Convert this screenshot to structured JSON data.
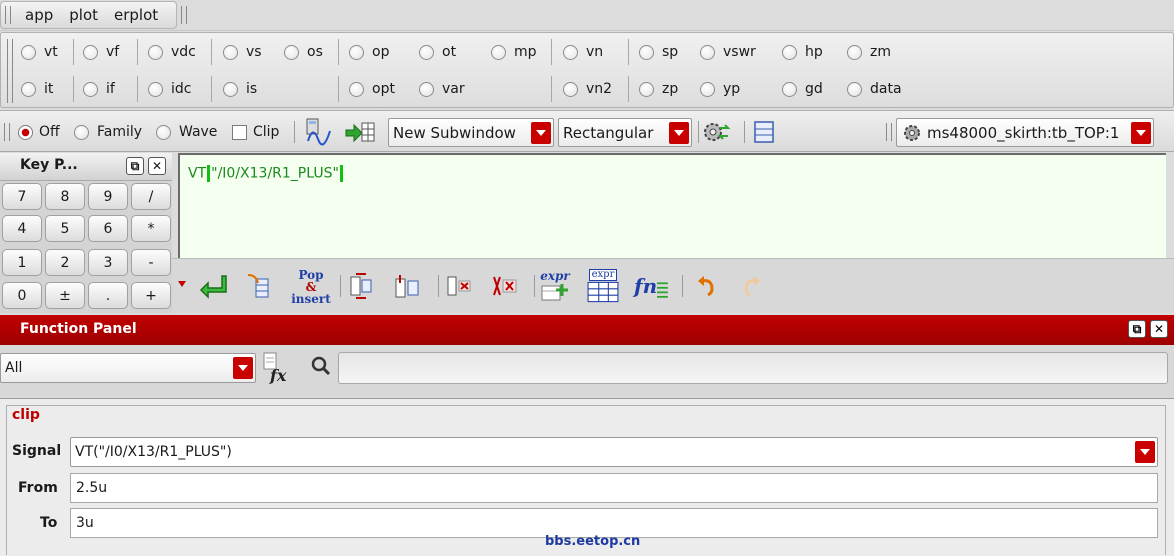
{
  "menubar": {
    "items": [
      "app",
      "plot",
      "erplot"
    ]
  },
  "radios": {
    "row1": [
      "vt",
      "vf",
      "vdc",
      "vs",
      "os",
      "op",
      "ot",
      "mp",
      "vn",
      "sp",
      "vswr",
      "hp",
      "zm"
    ],
    "row2": [
      "it",
      "if",
      "idc",
      "is",
      "opt",
      "var",
      "vn2",
      "zp",
      "yp",
      "gd",
      "data"
    ]
  },
  "toolbar": {
    "off": "Off",
    "family": "Family",
    "wave": "Wave",
    "clip": "Clip",
    "subwindow": "New Subwindow",
    "shape": "Rectangular",
    "session": "ms48000_skirth:tb_TOP:1"
  },
  "keypad": {
    "title": "Key P...",
    "keys": [
      "7",
      "8",
      "9",
      "/",
      "4",
      "5",
      "6",
      "*",
      "1",
      "2",
      "3",
      "-",
      "0",
      "±",
      ".",
      "+"
    ]
  },
  "buffer": {
    "fn": "VT",
    "arg": "\"/I0/X13/R1_PLUS\""
  },
  "icontools": {
    "pop_line1": "Pop",
    "pop_line2": "&",
    "pop_line3": "insert",
    "expr": "expr",
    "fn": "fn"
  },
  "function_panel": {
    "title": "Function Panel",
    "category": "All",
    "search_placeholder": "",
    "section": "clip",
    "signal_label": "Signal",
    "signal_value": "VT(\"/I0/X13/R1_PLUS\")",
    "from_label": "From",
    "from_value": "2.5u",
    "to_label": "To",
    "to_value": "3u"
  },
  "watermark": "bbs.eetop.cn",
  "colors": {
    "accent": "#c10000",
    "buffer_text": "#1c8a1c",
    "buffer_bg": "#f4fff0"
  }
}
